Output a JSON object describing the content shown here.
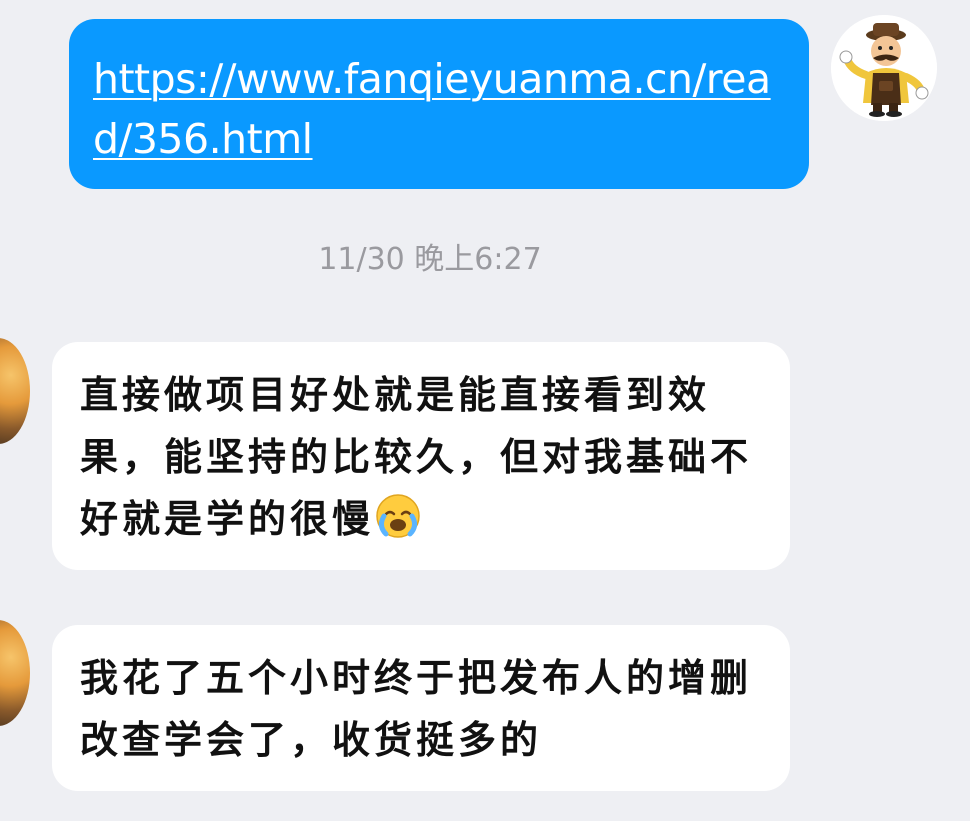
{
  "messages": {
    "outgoing_link": "https://www.fanqieyuanma.cn/read/356.html",
    "timestamp": "11/30 晚上6:27",
    "incoming_1": "直接做项目好处就是能直接看到效果，能坚持的比较久，但对我基础不好就是学的很慢",
    "incoming_1_emoji": "crying-face-emoji",
    "incoming_2": "我花了五个小时终于把发布人的增删改查学会了，收货挺多的"
  },
  "icons": {
    "right_avatar": "cartoon-man-avatar",
    "left_avatar": "landscape-avatar"
  },
  "colors": {
    "background": "#eeeff3",
    "outgoing_bubble": "#0a99ff",
    "incoming_bubble": "#ffffff",
    "timestamp_text": "#9a9a9f"
  }
}
